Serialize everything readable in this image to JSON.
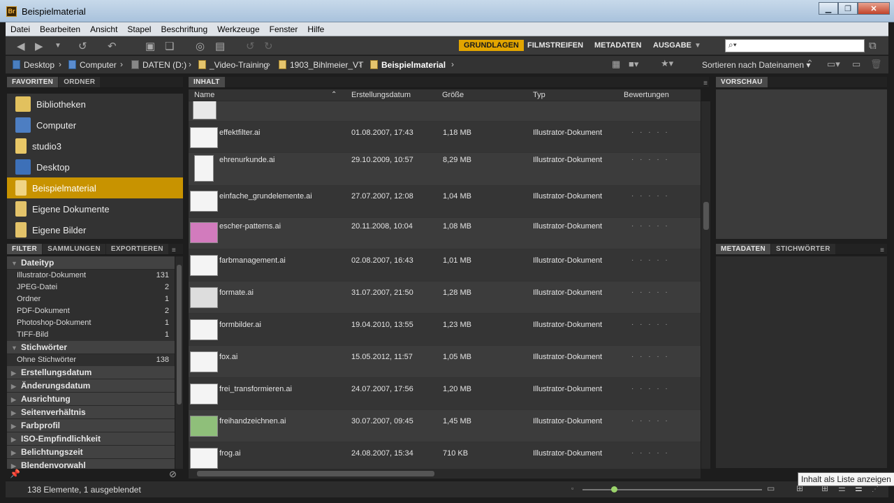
{
  "window": {
    "title": "Beispielmaterial",
    "app_icon": "Br"
  },
  "menu": [
    "Datei",
    "Bearbeiten",
    "Ansicht",
    "Stapel",
    "Beschriftung",
    "Werkzeuge",
    "Fenster",
    "Hilfe"
  ],
  "workspaces": {
    "grundlagen": "GRUNDLAGEN",
    "filmstreifen": "FILMSTREIFEN",
    "metadaten": "METADATEN",
    "ausgabe": "AUSGABE"
  },
  "accent": "#e2a500",
  "search": {
    "value": "⌕▾"
  },
  "path": {
    "desktop": "Desktop",
    "computer": "Computer",
    "daten": "DATEN (D:)",
    "video": "_Video-Training",
    "course": "1903_Bihlmeier_VT",
    "current": "Beispielmaterial"
  },
  "sort_label": "Sortieren nach Dateinamen",
  "favorites": {
    "tab_fav": "FAVORITEN",
    "tab_ordner": "ORDNER",
    "items": [
      "Bibliotheken",
      "Computer",
      "studio3",
      "Desktop",
      "Beispielmaterial",
      "Eigene Dokumente",
      "Eigene Bilder"
    ]
  },
  "filter": {
    "tab_filter": "FILTER",
    "tab_samml": "SAMMLUNGEN",
    "tab_export": "EXPORTIEREN",
    "dateityp": "Dateityp",
    "types": [
      {
        "n": "Illustrator-Dokument",
        "c": "131"
      },
      {
        "n": "JPEG-Datei",
        "c": "2"
      },
      {
        "n": "Ordner",
        "c": "1"
      },
      {
        "n": "PDF-Dokument",
        "c": "2"
      },
      {
        "n": "Photoshop-Dokument",
        "c": "1"
      },
      {
        "n": "TIFF-Bild",
        "c": "1"
      }
    ],
    "stichwoerter": "Stichwörter",
    "ohne": {
      "n": "Ohne Stichwörter",
      "c": "138"
    },
    "collapsed": [
      "Erstellungsdatum",
      "Änderungsdatum",
      "Ausrichtung",
      "Seitenverhältnis",
      "Farbprofil",
      "ISO-Empfindlichkeit",
      "Belichtungszeit",
      "Blendenvorwahl"
    ]
  },
  "content": {
    "tab": "INHALT",
    "headers": {
      "name": "Name",
      "date": "Erstellungsdatum",
      "size": "Größe",
      "type": "Typ",
      "rating": "Bewertungen"
    },
    "rows": [
      {
        "name": "effektfilter.ai",
        "date": "01.08.2007, 17:43",
        "size": "1,18 MB",
        "type": "Illustrator-Dokument"
      },
      {
        "name": "ehrenurkunde.ai",
        "date": "29.10.2009, 10:57",
        "size": "8,29 MB",
        "type": "Illustrator-Dokument"
      },
      {
        "name": "einfache_grundelemente.ai",
        "date": "27.07.2007, 12:08",
        "size": "1,04 MB",
        "type": "Illustrator-Dokument"
      },
      {
        "name": "escher-patterns.ai",
        "date": "20.11.2008, 10:04",
        "size": "1,08 MB",
        "type": "Illustrator-Dokument"
      },
      {
        "name": "farbmanagement.ai",
        "date": "02.08.2007, 16:43",
        "size": "1,01 MB",
        "type": "Illustrator-Dokument"
      },
      {
        "name": "formate.ai",
        "date": "31.07.2007, 21:50",
        "size": "1,28 MB",
        "type": "Illustrator-Dokument"
      },
      {
        "name": "formbilder.ai",
        "date": "19.04.2010, 13:55",
        "size": "1,23 MB",
        "type": "Illustrator-Dokument"
      },
      {
        "name": "fox.ai",
        "date": "15.05.2012, 11:57",
        "size": "1,05 MB",
        "type": "Illustrator-Dokument"
      },
      {
        "name": "frei_transformieren.ai",
        "date": "24.07.2007, 17:56",
        "size": "1,20 MB",
        "type": "Illustrator-Dokument"
      },
      {
        "name": "freihandzeichnen.ai",
        "date": "30.07.2007, 09:45",
        "size": "1,45 MB",
        "type": "Illustrator-Dokument"
      },
      {
        "name": "frog.ai",
        "date": "24.08.2007, 15:34",
        "size": "710 KB",
        "type": "Illustrator-Dokument"
      }
    ],
    "rating_dots": "· · · · ·"
  },
  "preview_tab": "VORSCHAU",
  "meta_tabs": {
    "metadaten": "METADATEN",
    "stichwoerter": "STICHWÖRTER"
  },
  "status": "138 Elemente, 1 ausgeblendet",
  "tooltip": "Inhalt als Liste anzeigen"
}
